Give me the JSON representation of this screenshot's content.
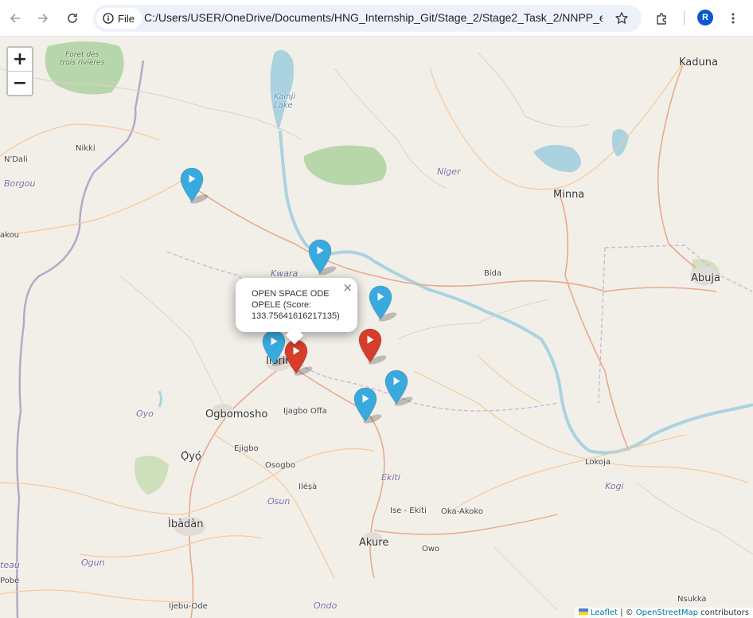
{
  "browser": {
    "file_label": "File",
    "url": "C:/Users/USER/OneDrive/Documents/HNG_Internship_Git/Stage_2/Stage2_Task_2/NNPP_ele...",
    "profile_initial": "R"
  },
  "map": {
    "zoom_in": "+",
    "zoom_out": "−",
    "places": {
      "kaduna": "Kaduna",
      "minna": "Minna",
      "abuja": "Abuja",
      "bida": "Bida",
      "lokoja": "Lokoja",
      "ilorin": "Ilorin",
      "ogbomosho": "Ogbomosho",
      "oyo": "Ọ̀yọ́",
      "ibadan": "Ìbàdàn",
      "akure": "Akure",
      "nikki": "Nikki",
      "ndali": "N'Dali",
      "ijagbo_offa": "Ijagbo Offa",
      "ejigbo": "Ejigbo",
      "osogbo": "Osogbo",
      "ilesa": "Iléṣà",
      "ise_ekiti": "Ise - Ekiti",
      "oka_akoko": "Oka-Akoko",
      "owo": "Owo",
      "nsukka": "Nsukka",
      "ijebu_ode": "Ijebu-Ode",
      "pobe": "Pobè",
      "akou": "akou"
    },
    "regions": {
      "borgou": "Borgou",
      "niger": "Niger",
      "kwara": "Kwara",
      "oyo_state": "Oyo",
      "osun": "Osun",
      "ekiti": "Ekiti",
      "kogi": "Kogi",
      "ogun": "Ogun",
      "ondo": "Ondo",
      "plateau": "teau"
    },
    "water": {
      "kainji": "Kainji\nLake"
    },
    "forest": "Foret des\ntrois rivières",
    "popup": {
      "text": "OPEN SPACE ODE OPELE (Score: 133.75641616217135)",
      "close": "×"
    },
    "markers": [
      {
        "color": "blue"
      },
      {
        "color": "blue"
      },
      {
        "color": "blue"
      },
      {
        "color": "blue"
      },
      {
        "color": "red"
      },
      {
        "color": "red"
      },
      {
        "color": "blue"
      },
      {
        "color": "blue"
      }
    ],
    "colors": {
      "marker_blue": "#38aadd",
      "marker_red": "#d63e2a",
      "map_bg": "#f2efe9",
      "water": "#aad3df",
      "forest": "#add19e"
    },
    "attribution": {
      "leaflet": "Leaflet",
      "separator": " | © ",
      "osm": "OpenStreetMap",
      "suffix": " contributors"
    }
  }
}
